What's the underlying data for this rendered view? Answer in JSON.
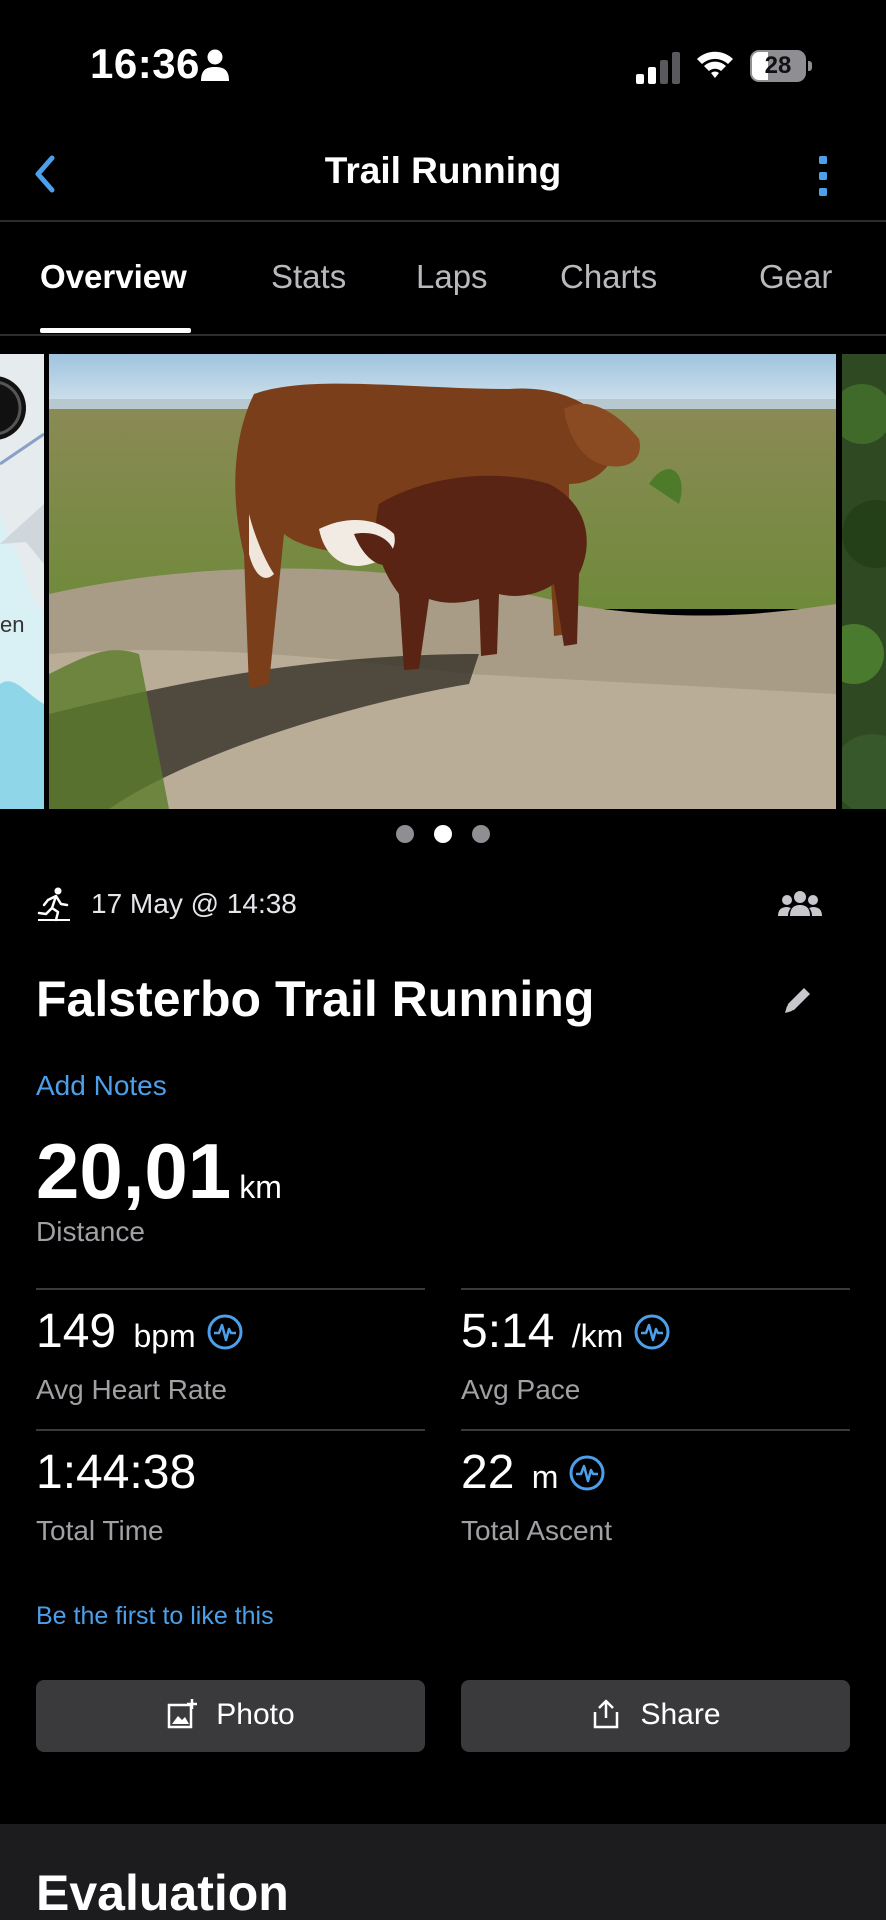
{
  "status_bar": {
    "time": "16:36",
    "battery": "28"
  },
  "nav": {
    "title": "Trail Running"
  },
  "tabs": [
    {
      "label": "Overview",
      "active": true
    },
    {
      "label": "Stats"
    },
    {
      "label": "Laps"
    },
    {
      "label": "Charts"
    },
    {
      "label": "Gear"
    }
  ],
  "carousel": {
    "map_partial_label": "en",
    "slide_count": 3,
    "active_index": 1
  },
  "activity": {
    "date": "17 May @ 14:38",
    "title": "Falsterbo Trail Running",
    "add_notes": "Add Notes"
  },
  "distance": {
    "value": "20,01",
    "unit": "km",
    "label": "Distance"
  },
  "stats": [
    {
      "value": "149",
      "unit": "bpm",
      "label": "Avg Heart Rate",
      "has_chart_icon": true
    },
    {
      "value": "5:14",
      "unit": "/km",
      "label": "Avg Pace",
      "has_chart_icon": true
    },
    {
      "value": "1:44:38",
      "unit": "",
      "label": "Total Time",
      "has_chart_icon": false
    },
    {
      "value": "22",
      "unit": "m",
      "label": "Total Ascent",
      "has_chart_icon": true
    }
  ],
  "like_text": "Be the first to like this",
  "buttons": {
    "photo": "Photo",
    "share": "Share"
  },
  "evaluation": {
    "title": "Evaluation"
  },
  "colors": {
    "accent": "#4c9fe8",
    "background": "#000000",
    "button": "#3a3a3c"
  }
}
